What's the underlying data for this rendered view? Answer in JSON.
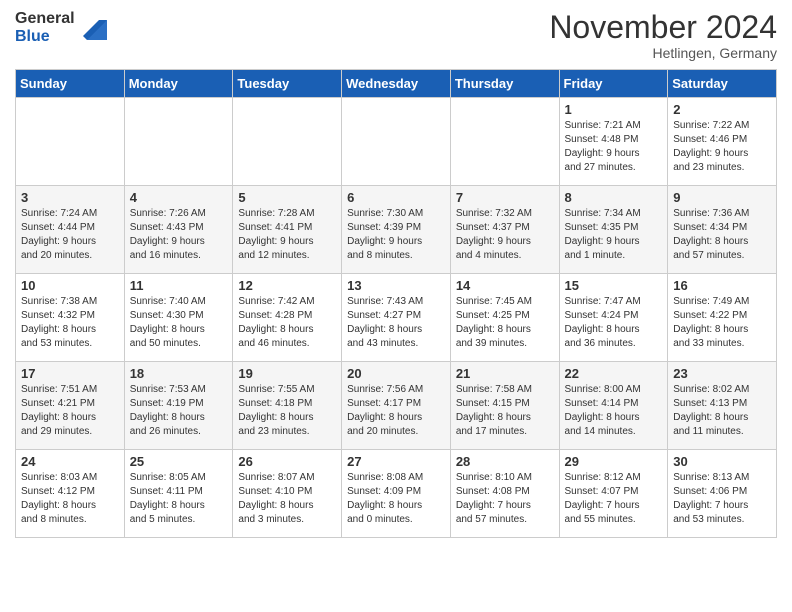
{
  "header": {
    "logo_general": "General",
    "logo_blue": "Blue",
    "month_title": "November 2024",
    "location": "Hetlingen, Germany"
  },
  "days_of_week": [
    "Sunday",
    "Monday",
    "Tuesday",
    "Wednesday",
    "Thursday",
    "Friday",
    "Saturday"
  ],
  "weeks": [
    {
      "days": [
        {
          "num": "",
          "info": ""
        },
        {
          "num": "",
          "info": ""
        },
        {
          "num": "",
          "info": ""
        },
        {
          "num": "",
          "info": ""
        },
        {
          "num": "",
          "info": ""
        },
        {
          "num": "1",
          "info": "Sunrise: 7:21 AM\nSunset: 4:48 PM\nDaylight: 9 hours\nand 27 minutes."
        },
        {
          "num": "2",
          "info": "Sunrise: 7:22 AM\nSunset: 4:46 PM\nDaylight: 9 hours\nand 23 minutes."
        }
      ]
    },
    {
      "days": [
        {
          "num": "3",
          "info": "Sunrise: 7:24 AM\nSunset: 4:44 PM\nDaylight: 9 hours\nand 20 minutes."
        },
        {
          "num": "4",
          "info": "Sunrise: 7:26 AM\nSunset: 4:43 PM\nDaylight: 9 hours\nand 16 minutes."
        },
        {
          "num": "5",
          "info": "Sunrise: 7:28 AM\nSunset: 4:41 PM\nDaylight: 9 hours\nand 12 minutes."
        },
        {
          "num": "6",
          "info": "Sunrise: 7:30 AM\nSunset: 4:39 PM\nDaylight: 9 hours\nand 8 minutes."
        },
        {
          "num": "7",
          "info": "Sunrise: 7:32 AM\nSunset: 4:37 PM\nDaylight: 9 hours\nand 4 minutes."
        },
        {
          "num": "8",
          "info": "Sunrise: 7:34 AM\nSunset: 4:35 PM\nDaylight: 9 hours\nand 1 minute."
        },
        {
          "num": "9",
          "info": "Sunrise: 7:36 AM\nSunset: 4:34 PM\nDaylight: 8 hours\nand 57 minutes."
        }
      ]
    },
    {
      "days": [
        {
          "num": "10",
          "info": "Sunrise: 7:38 AM\nSunset: 4:32 PM\nDaylight: 8 hours\nand 53 minutes."
        },
        {
          "num": "11",
          "info": "Sunrise: 7:40 AM\nSunset: 4:30 PM\nDaylight: 8 hours\nand 50 minutes."
        },
        {
          "num": "12",
          "info": "Sunrise: 7:42 AM\nSunset: 4:28 PM\nDaylight: 8 hours\nand 46 minutes."
        },
        {
          "num": "13",
          "info": "Sunrise: 7:43 AM\nSunset: 4:27 PM\nDaylight: 8 hours\nand 43 minutes."
        },
        {
          "num": "14",
          "info": "Sunrise: 7:45 AM\nSunset: 4:25 PM\nDaylight: 8 hours\nand 39 minutes."
        },
        {
          "num": "15",
          "info": "Sunrise: 7:47 AM\nSunset: 4:24 PM\nDaylight: 8 hours\nand 36 minutes."
        },
        {
          "num": "16",
          "info": "Sunrise: 7:49 AM\nSunset: 4:22 PM\nDaylight: 8 hours\nand 33 minutes."
        }
      ]
    },
    {
      "days": [
        {
          "num": "17",
          "info": "Sunrise: 7:51 AM\nSunset: 4:21 PM\nDaylight: 8 hours\nand 29 minutes."
        },
        {
          "num": "18",
          "info": "Sunrise: 7:53 AM\nSunset: 4:19 PM\nDaylight: 8 hours\nand 26 minutes."
        },
        {
          "num": "19",
          "info": "Sunrise: 7:55 AM\nSunset: 4:18 PM\nDaylight: 8 hours\nand 23 minutes."
        },
        {
          "num": "20",
          "info": "Sunrise: 7:56 AM\nSunset: 4:17 PM\nDaylight: 8 hours\nand 20 minutes."
        },
        {
          "num": "21",
          "info": "Sunrise: 7:58 AM\nSunset: 4:15 PM\nDaylight: 8 hours\nand 17 minutes."
        },
        {
          "num": "22",
          "info": "Sunrise: 8:00 AM\nSunset: 4:14 PM\nDaylight: 8 hours\nand 14 minutes."
        },
        {
          "num": "23",
          "info": "Sunrise: 8:02 AM\nSunset: 4:13 PM\nDaylight: 8 hours\nand 11 minutes."
        }
      ]
    },
    {
      "days": [
        {
          "num": "24",
          "info": "Sunrise: 8:03 AM\nSunset: 4:12 PM\nDaylight: 8 hours\nand 8 minutes."
        },
        {
          "num": "25",
          "info": "Sunrise: 8:05 AM\nSunset: 4:11 PM\nDaylight: 8 hours\nand 5 minutes."
        },
        {
          "num": "26",
          "info": "Sunrise: 8:07 AM\nSunset: 4:10 PM\nDaylight: 8 hours\nand 3 minutes."
        },
        {
          "num": "27",
          "info": "Sunrise: 8:08 AM\nSunset: 4:09 PM\nDaylight: 8 hours\nand 0 minutes."
        },
        {
          "num": "28",
          "info": "Sunrise: 8:10 AM\nSunset: 4:08 PM\nDaylight: 7 hours\nand 57 minutes."
        },
        {
          "num": "29",
          "info": "Sunrise: 8:12 AM\nSunset: 4:07 PM\nDaylight: 7 hours\nand 55 minutes."
        },
        {
          "num": "30",
          "info": "Sunrise: 8:13 AM\nSunset: 4:06 PM\nDaylight: 7 hours\nand 53 minutes."
        }
      ]
    }
  ]
}
